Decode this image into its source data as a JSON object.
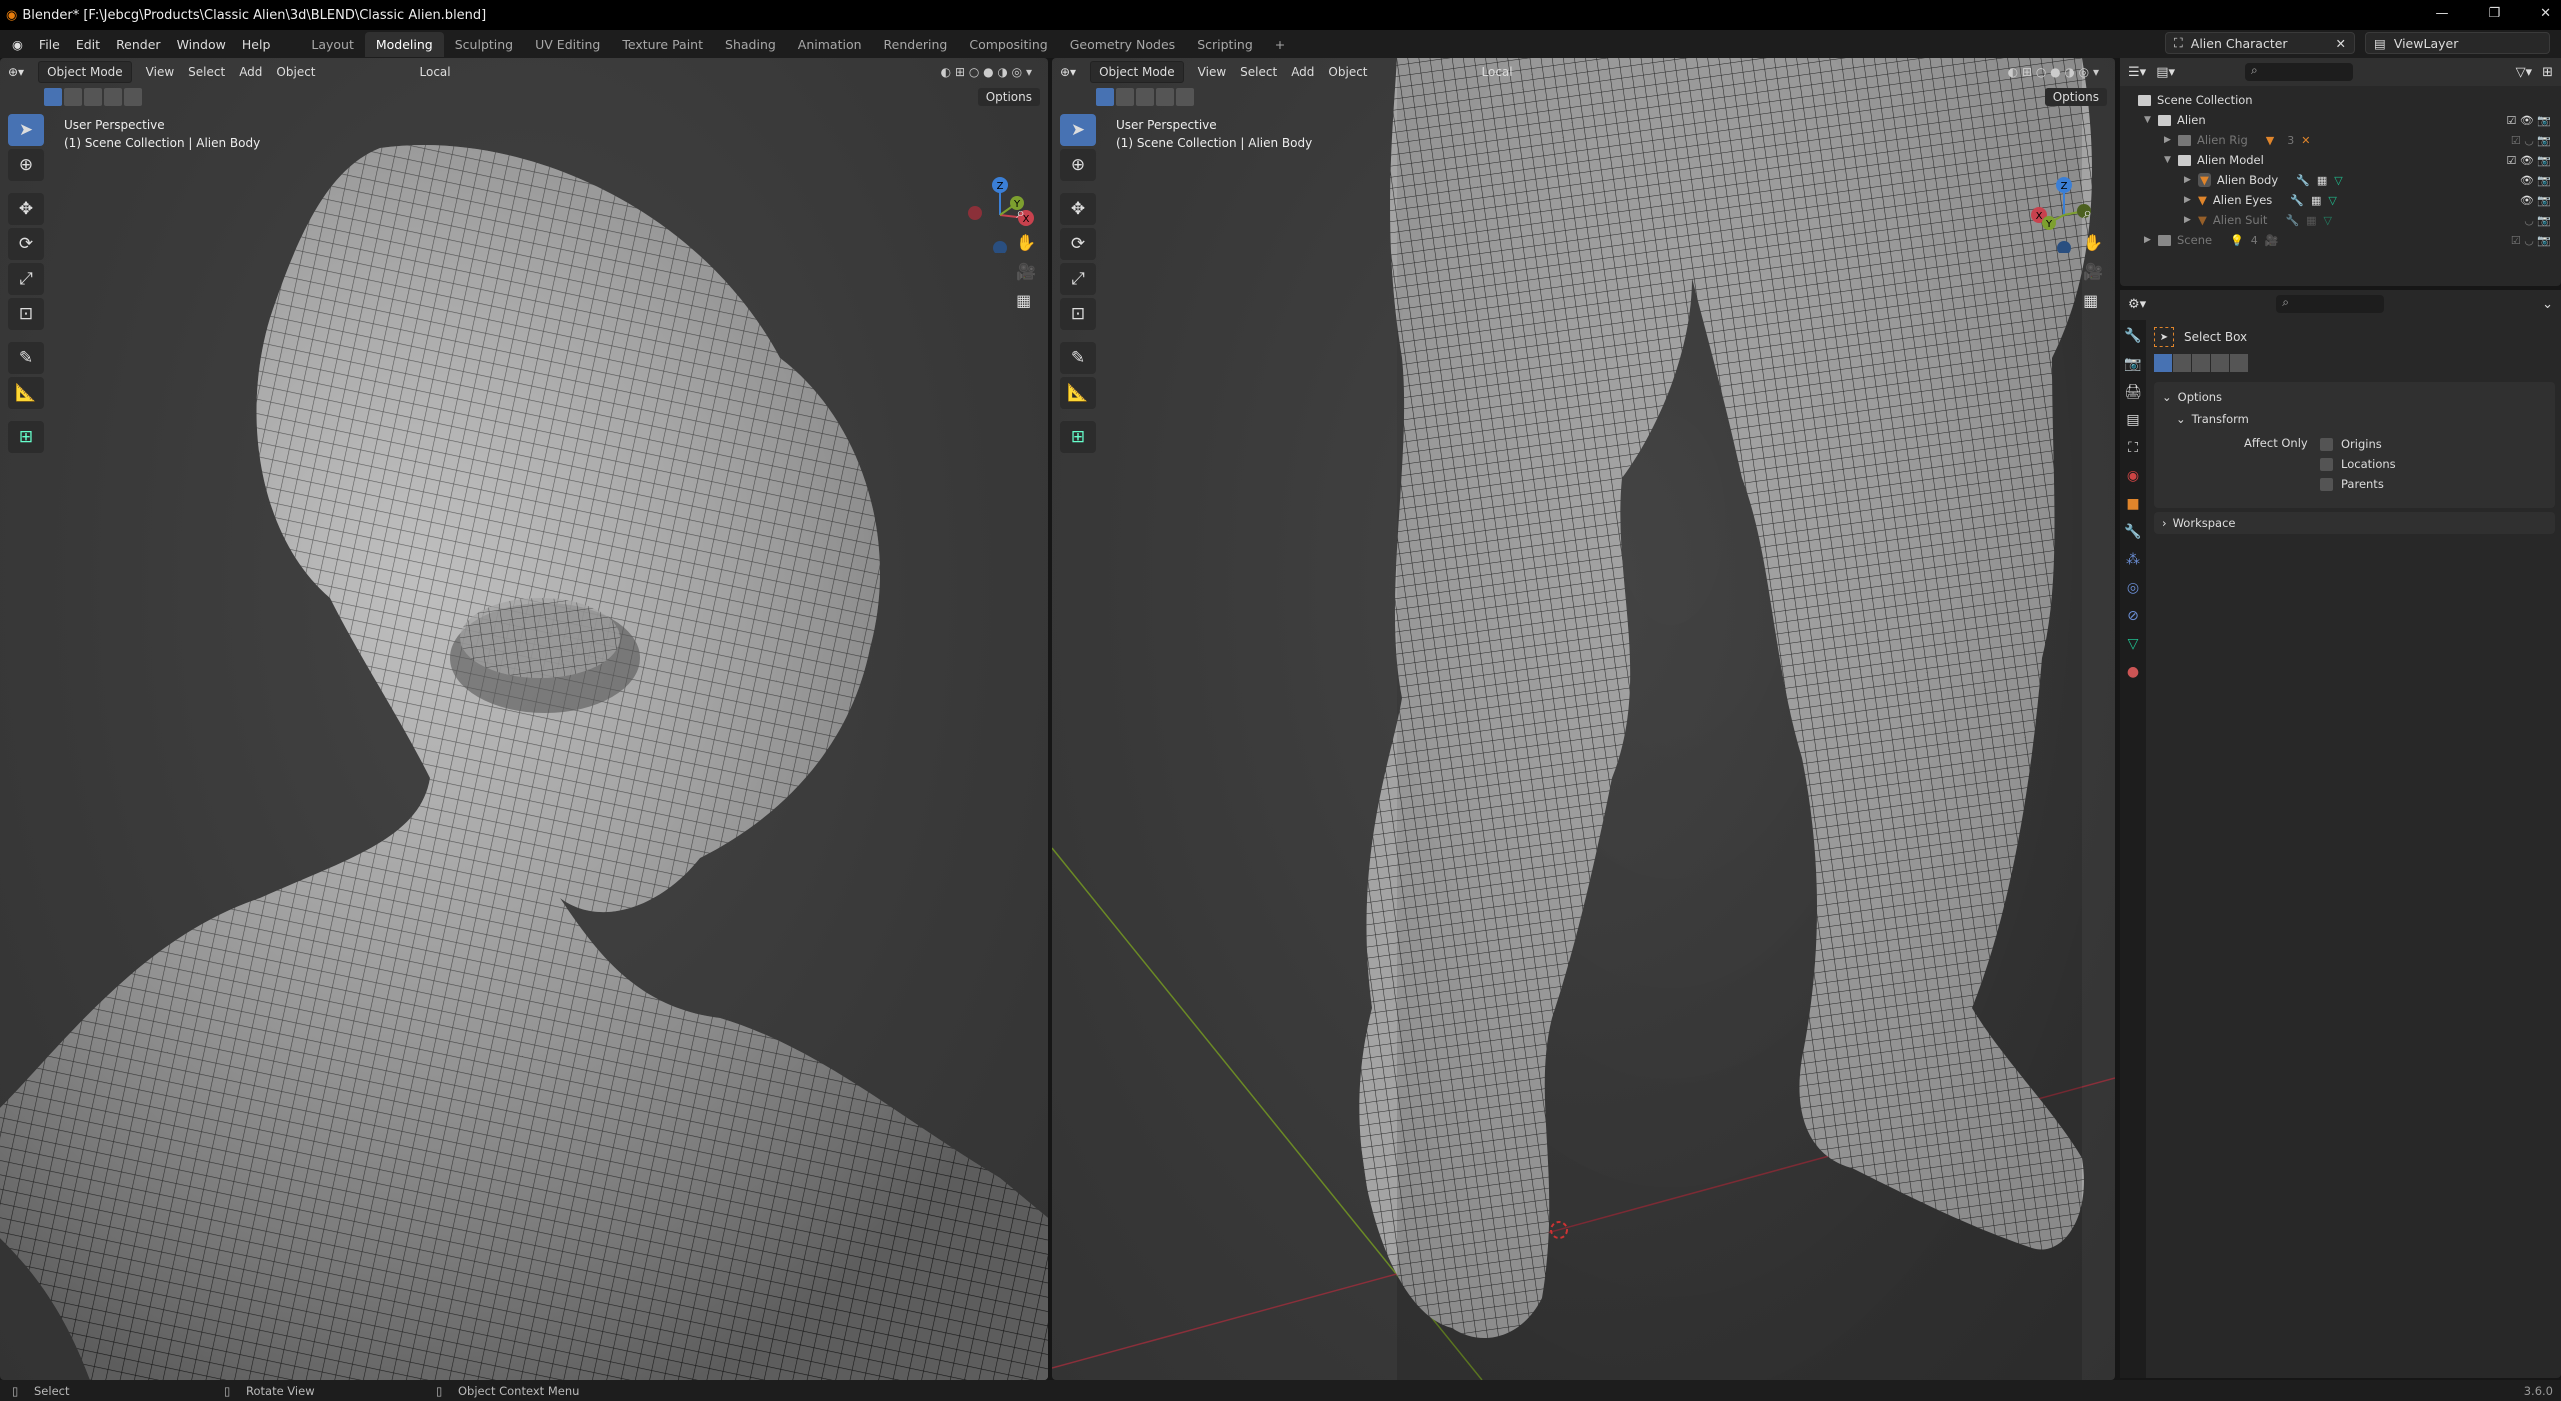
{
  "window": {
    "title": "Blender* [F:\\Jebcg\\Products\\Classic Alien\\3d\\BLEND\\Classic Alien.blend]"
  },
  "menu": [
    "File",
    "Edit",
    "Render",
    "Window",
    "Help"
  ],
  "workspaces": [
    "Layout",
    "Modeling",
    "Sculpting",
    "UV Editing",
    "Texture Paint",
    "Shading",
    "Animation",
    "Rendering",
    "Compositing",
    "Geometry Nodes",
    "Scripting",
    "+"
  ],
  "active_workspace": "Modeling",
  "scene": "Alien Character",
  "view_layer": "ViewLayer",
  "viewport_header": {
    "mode": "Object Mode",
    "menus": [
      "View",
      "Select",
      "Add",
      "Object"
    ],
    "orientation": "Local",
    "options": "Options"
  },
  "viewport_info": {
    "line1": "User Perspective",
    "line2": "(1) Scene Collection | Alien Body"
  },
  "gizmo": {
    "z": "Z",
    "y": "Y",
    "x": "X"
  },
  "outliner": {
    "root": "Scene Collection",
    "rows": [
      {
        "label": "Alien",
        "level": 1,
        "dim": false,
        "badge": ""
      },
      {
        "label": "Alien Rig",
        "level": 2,
        "dim": true,
        "badge": "3"
      },
      {
        "label": "Alien Model",
        "level": 2,
        "dim": false,
        "badge": ""
      },
      {
        "label": "Alien Body",
        "level": 3,
        "dim": false,
        "badge": ""
      },
      {
        "label": "Alien Eyes",
        "level": 3,
        "dim": false,
        "badge": ""
      },
      {
        "label": "Alien Suit",
        "level": 3,
        "dim": true,
        "badge": ""
      },
      {
        "label": "Scene",
        "level": 1,
        "dim": true,
        "badge": "4"
      }
    ]
  },
  "properties": {
    "tool": "Select Box",
    "options": "Options",
    "transform": "Transform",
    "affect_only": "Affect Only",
    "checks": [
      {
        "label": "Origins",
        "checked": false
      },
      {
        "label": "Locations",
        "checked": false
      },
      {
        "label": "Parents",
        "checked": false
      }
    ],
    "workspace": "Workspace"
  },
  "status": {
    "select": "Select",
    "rotate": "Rotate View",
    "context": "Object Context Menu",
    "version": "3.6.0"
  },
  "colors": {
    "accent": "#4772b3",
    "orange": "#e0852b",
    "x_axis": "#c8424e",
    "y_axis": "#7da02f",
    "z_axis": "#3b7fd6"
  }
}
